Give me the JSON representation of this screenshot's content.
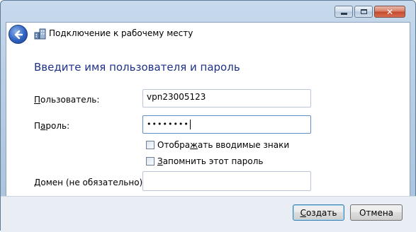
{
  "window": {
    "caption_buttons": {
      "minimize_icon": "minimize-icon",
      "maximize_icon": "maximize-icon",
      "close_icon": "close-icon"
    }
  },
  "header": {
    "back_icon": "back-arrow-icon",
    "wizard_icon": "network-workplace-icon",
    "title": "Подключение к рабочему месту"
  },
  "main": {
    "heading": "Введите имя пользователя и пароль",
    "username": {
      "label_prefix": "П",
      "label_rest": "ользователь:",
      "value": "vpn23005123"
    },
    "password": {
      "label_prefix": "П",
      "label_mid": "а",
      "label_rest": "роль:",
      "masked_value": "••••••••"
    },
    "show_chars": {
      "label_pre": "Отобра",
      "label_accel": "ж",
      "label_post": "ать вводимые знаки",
      "checked": false
    },
    "remember": {
      "label_accel": "З",
      "label_post": "апомнить этот пароль",
      "checked": false
    },
    "domain": {
      "label_pre": "",
      "label_accel": "Д",
      "label_post": "омен (не обязательно):",
      "value": ""
    }
  },
  "footer": {
    "create_accel": "С",
    "create_rest": "оздать",
    "cancel_label": "Отмена"
  },
  "colors": {
    "heading": "#1e3287",
    "window_frame": "#b9cfe6",
    "close_button": "#c4472a"
  }
}
